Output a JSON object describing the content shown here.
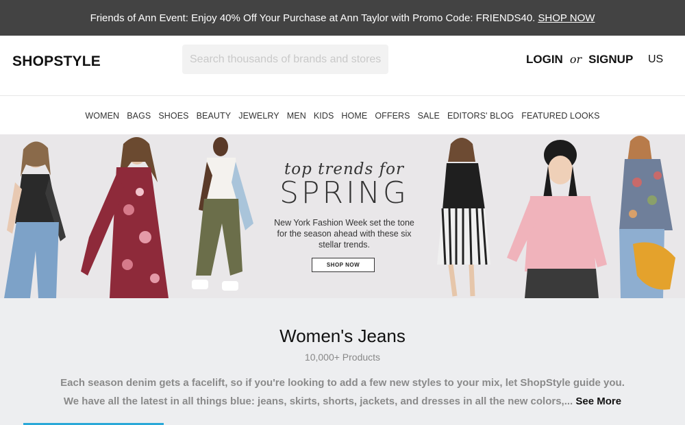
{
  "promo": {
    "text": "Friends of Ann Event: Enjoy 40% Off Your Purchase at Ann Taylor with Promo Code: FRIENDS40.",
    "link": "SHOP NOW"
  },
  "header": {
    "logo": "SHOPSTYLE",
    "search_placeholder": "Search thousands of brands and stores",
    "login": "LOGIN",
    "or": "or",
    "signup": "SIGNUP",
    "region": "US"
  },
  "nav": [
    "WOMEN",
    "BAGS",
    "SHOES",
    "BEAUTY",
    "JEWELRY",
    "MEN",
    "KIDS",
    "HOME",
    "OFFERS",
    "SALE",
    "EDITORS' BLOG",
    "FEATURED LOOKS"
  ],
  "hero": {
    "script": "top trends for",
    "headline": "SPRING",
    "subtext": "New York Fashion Week set the tone for the season ahead with these six stellar trends.",
    "button": "SHOP NOW"
  },
  "category": {
    "title": "Women's Jeans",
    "count": "10,000+ Products",
    "description": "Each season denim gets a facelift, so if you're looking to add a few new styles to your mix, let ShopStyle guide you. We have all the latest in all things blue: jeans, skirts, shorts, jackets, and dresses in all the new colors,...",
    "see_more": "See More"
  },
  "colors": {
    "promo_bg": "#434343",
    "hero_bg": "#e9e7e9",
    "section_bg": "#edeef0",
    "accent": "#2aa8d8"
  }
}
